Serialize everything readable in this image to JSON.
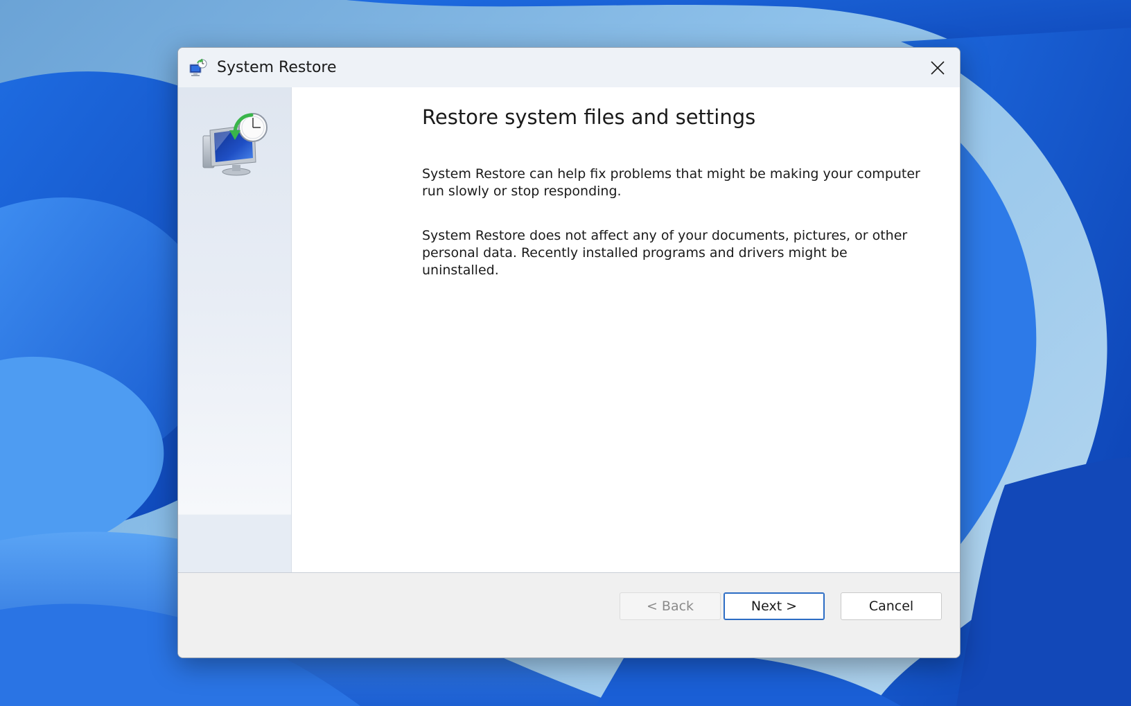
{
  "window": {
    "title": "System Restore",
    "close_icon": "close-icon",
    "app_icon": "system-restore-icon"
  },
  "sidebar": {
    "icon": "monitor-restore-clock-icon"
  },
  "main": {
    "heading": "Restore system files and settings",
    "paragraphs": [
      "System Restore can help fix problems that might be making your computer run slowly or stop responding.",
      "System Restore does not affect any of your documents, pictures, or other personal data. Recently installed programs and drivers might be uninstalled."
    ]
  },
  "footer": {
    "back_label": "< Back",
    "back_enabled": false,
    "next_label": "Next >",
    "cancel_label": "Cancel"
  },
  "colors": {
    "accent": "#2b6cc4",
    "titlebar": "#eef2f7",
    "footer": "#f0f0f0",
    "wallpaper": "#1a5fd6"
  }
}
